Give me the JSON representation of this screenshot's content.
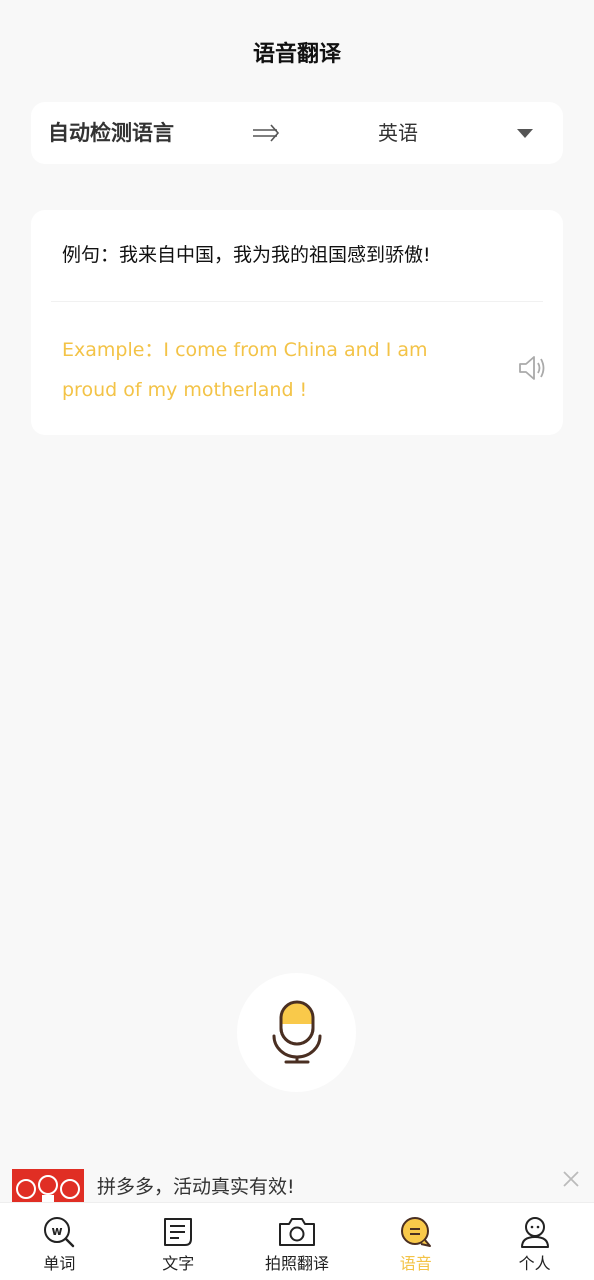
{
  "header": {
    "title": "语音翻译"
  },
  "language_bar": {
    "source": "自动检测语言",
    "target": "英语",
    "icons": {
      "arrow": "double-arrow-right-icon",
      "dropdown": "caret-down-icon"
    }
  },
  "example": {
    "source_text": "例句：我来自中国，我为我的祖国感到骄傲!",
    "translation_text": "Example：I come from China and I am proud of my motherland !",
    "speaker_icon": "speaker-icon"
  },
  "mic": {
    "icon": "microphone-icon"
  },
  "ad": {
    "text": "拼多多，活动真实有效!",
    "close_icon": "close-icon",
    "logo_icon": "pinduoduo-logo"
  },
  "tabbar": {
    "tabs": [
      {
        "label": "单词",
        "icon": "word-search-icon",
        "active": false
      },
      {
        "label": "文字",
        "icon": "text-doc-icon",
        "active": false
      },
      {
        "label": "拍照翻译",
        "icon": "camera-icon",
        "active": false
      },
      {
        "label": "语音",
        "icon": "voice-chat-icon",
        "active": true
      },
      {
        "label": "个人",
        "icon": "person-icon",
        "active": false
      }
    ]
  },
  "colors": {
    "accent": "#f3c347",
    "background": "#f8f8f8",
    "ad_red": "#e02e24"
  }
}
